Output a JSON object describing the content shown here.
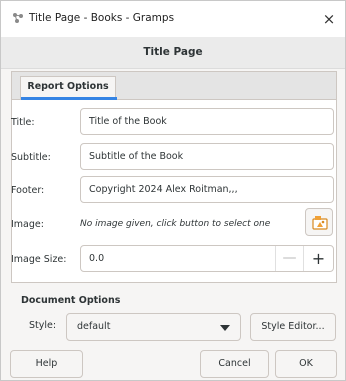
{
  "window": {
    "title": "Title Page - Books - Gramps",
    "close_glyph": "×"
  },
  "dialog": {
    "title": "Title Page"
  },
  "tabs": [
    {
      "label": "Report Options",
      "active": true
    }
  ],
  "report_options": {
    "title": {
      "label": "Title:",
      "value": "Title of the Book"
    },
    "subtitle": {
      "label": "Subtitle:",
      "value": "Subtitle of the Book"
    },
    "footer": {
      "label": "Footer:",
      "value": "Copyright 2024 Alex Roitman,,,"
    },
    "image": {
      "label": "Image:",
      "hint": "No image given, click button to select one",
      "button_icon": "image-select-icon"
    },
    "image_size": {
      "label": "Image Size:",
      "value": "0.0",
      "minus": "—",
      "plus": "+"
    }
  },
  "document_options": {
    "title": "Document Options",
    "style_label": "Style:",
    "style_value": "default",
    "style_editor_label": "Style Editor..."
  },
  "buttons": {
    "help": "Help",
    "cancel": "Cancel",
    "ok": "OK"
  },
  "colors": {
    "accent": "#3584e4",
    "background": "#f6f5f4",
    "icon_orange": "#f0a035"
  }
}
